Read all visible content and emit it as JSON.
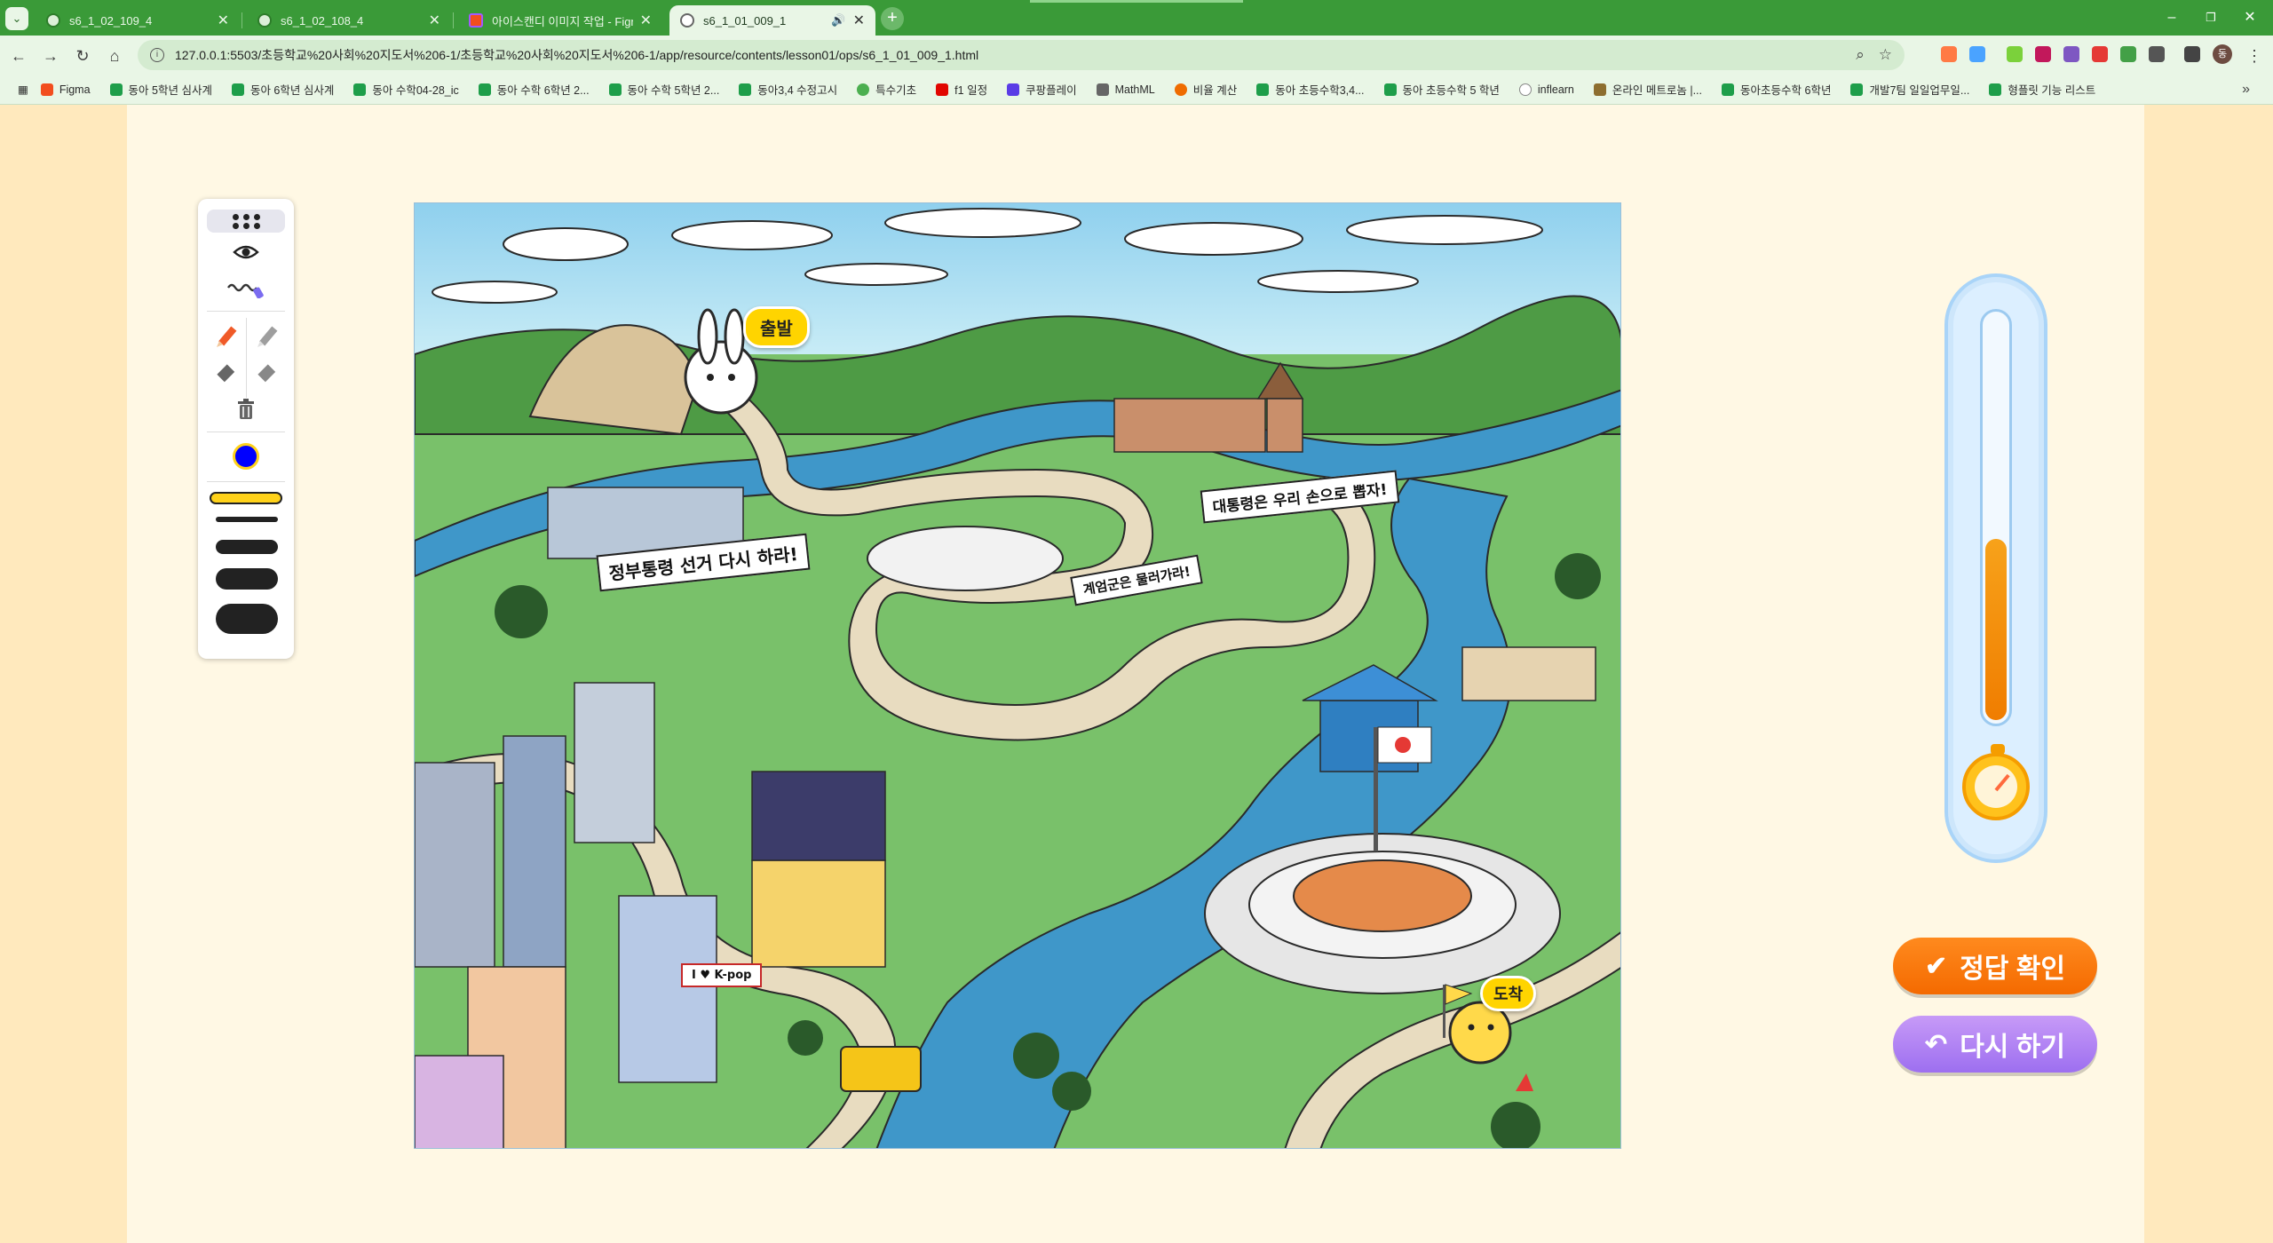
{
  "browser": {
    "tabs": [
      {
        "title": "s6_1_02_109_4"
      },
      {
        "title": "s6_1_02_108_4"
      },
      {
        "title": "아이스캔디 이미지 작업 - Figma"
      },
      {
        "title": "s6_1_01_009_1"
      }
    ],
    "active_tab": 3,
    "url": "127.0.0.1:5503/초등학교%20사회%20지도서%206-1/초등학교%20사회%20지도서%206-1/app/resource/contents/lesson01/ops/s6_1_01_009_1.html",
    "bookmarks": [
      "Figma",
      "동아 5학년 심사계",
      "동아 6학년 심사계",
      "동아 수학04-28_ic",
      "동아 수학 6학년 2...",
      "동아 수학 5학년 2...",
      "동아3,4 수정고시",
      "특수기초",
      "f1 일정",
      "쿠팡플레이",
      "MathML",
      "비율 계산",
      "동아 초등수학3,4...",
      "동아 초등수학 5 학년",
      "inflearn",
      "온라인 메트로놈 |...",
      "동아초등수학 6학년",
      "개발7팀 일일업무일...",
      "형플릿 기능 리스트"
    ],
    "profile_initial": "동"
  },
  "toolbox": {
    "pen_color": "#0000ff",
    "highlighter_color": "#ffd21a",
    "icons": [
      "drag-handle-icon",
      "eye-icon",
      "scribble-icon",
      "red-pencil-icon",
      "gray-pencil-icon",
      "gray-eraser-icon",
      "gray-eraser-alt-icon",
      "trash-icon"
    ]
  },
  "scene": {
    "start_label": "출발",
    "end_label": "도착",
    "banner1": "정부통령 선거 다시 하라!",
    "banner2": "대통령은 우리 손으로 뽑자!",
    "banner3": "계엄군은 물러가라!",
    "kpop_sign": "I ♥ K-pop"
  },
  "timer": {
    "remaining_fraction": 0.44
  },
  "buttons": {
    "check": "정답 확인",
    "retry": "다시 하기"
  },
  "colors": {
    "chrome": "#3a9a38",
    "check": "#f46a00",
    "retry": "#9d6ff0",
    "page_bg": "#fff8e4"
  }
}
